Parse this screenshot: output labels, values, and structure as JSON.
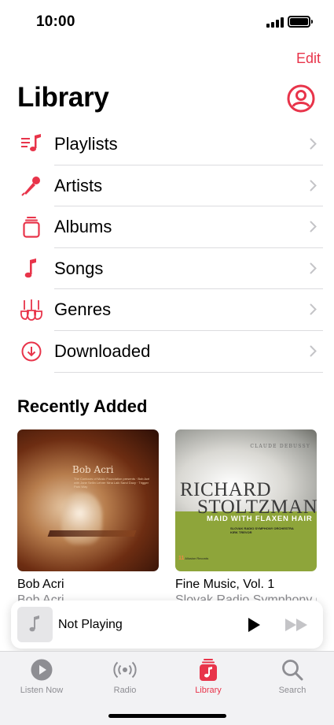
{
  "status_bar": {
    "time": "10:00"
  },
  "header": {
    "edit_label": "Edit",
    "title": "Library"
  },
  "library_items": [
    {
      "label": "Playlists",
      "icon": "playlists-icon"
    },
    {
      "label": "Artists",
      "icon": "microphone-icon"
    },
    {
      "label": "Albums",
      "icon": "album-stack-icon"
    },
    {
      "label": "Songs",
      "icon": "music-note-icon"
    },
    {
      "label": "Genres",
      "icon": "guitars-icon"
    },
    {
      "label": "Downloaded",
      "icon": "download-icon"
    }
  ],
  "recently_added": {
    "title": "Recently Added",
    "albums": [
      {
        "title": "Bob Acri",
        "artist": "Bob Acri",
        "cover_text": "Bob Acri",
        "cover_small_text": "The Contours of Music Foundation presents · Bob Acri with Jane Sellin Lehrer Nina Laik Sand Dozy · Trigger Park Way"
      },
      {
        "title": "Fine Music, Vol. 1",
        "artist": "Slovak Radio Symphony Orchestra",
        "cover_composer": "CLAUDE DEBUSSY",
        "cover_name_line1": "RICHARD",
        "cover_name_line2": "STOLTZMAN",
        "cover_subtitle": "MAID WITH FLAXEN HAIR",
        "cover_orchestra": "SLOVAK RADIO SYMPHONY ORCHESTRA",
        "cover_conductor": "KIRK TREVOR",
        "cover_logo_text": "Allusion Records"
      }
    ]
  },
  "mini_player": {
    "title": "Not Playing"
  },
  "tabs": [
    {
      "label": "Listen Now",
      "icon": "play-circle-icon",
      "active": false
    },
    {
      "label": "Radio",
      "icon": "radio-waves-icon",
      "active": false
    },
    {
      "label": "Library",
      "icon": "library-music-icon",
      "active": true
    },
    {
      "label": "Search",
      "icon": "search-icon",
      "active": false
    }
  ],
  "colors": {
    "accent": "#e8344a",
    "secondary_text": "#8e8e93",
    "tab_bar_bg": "#f2f2f4"
  }
}
